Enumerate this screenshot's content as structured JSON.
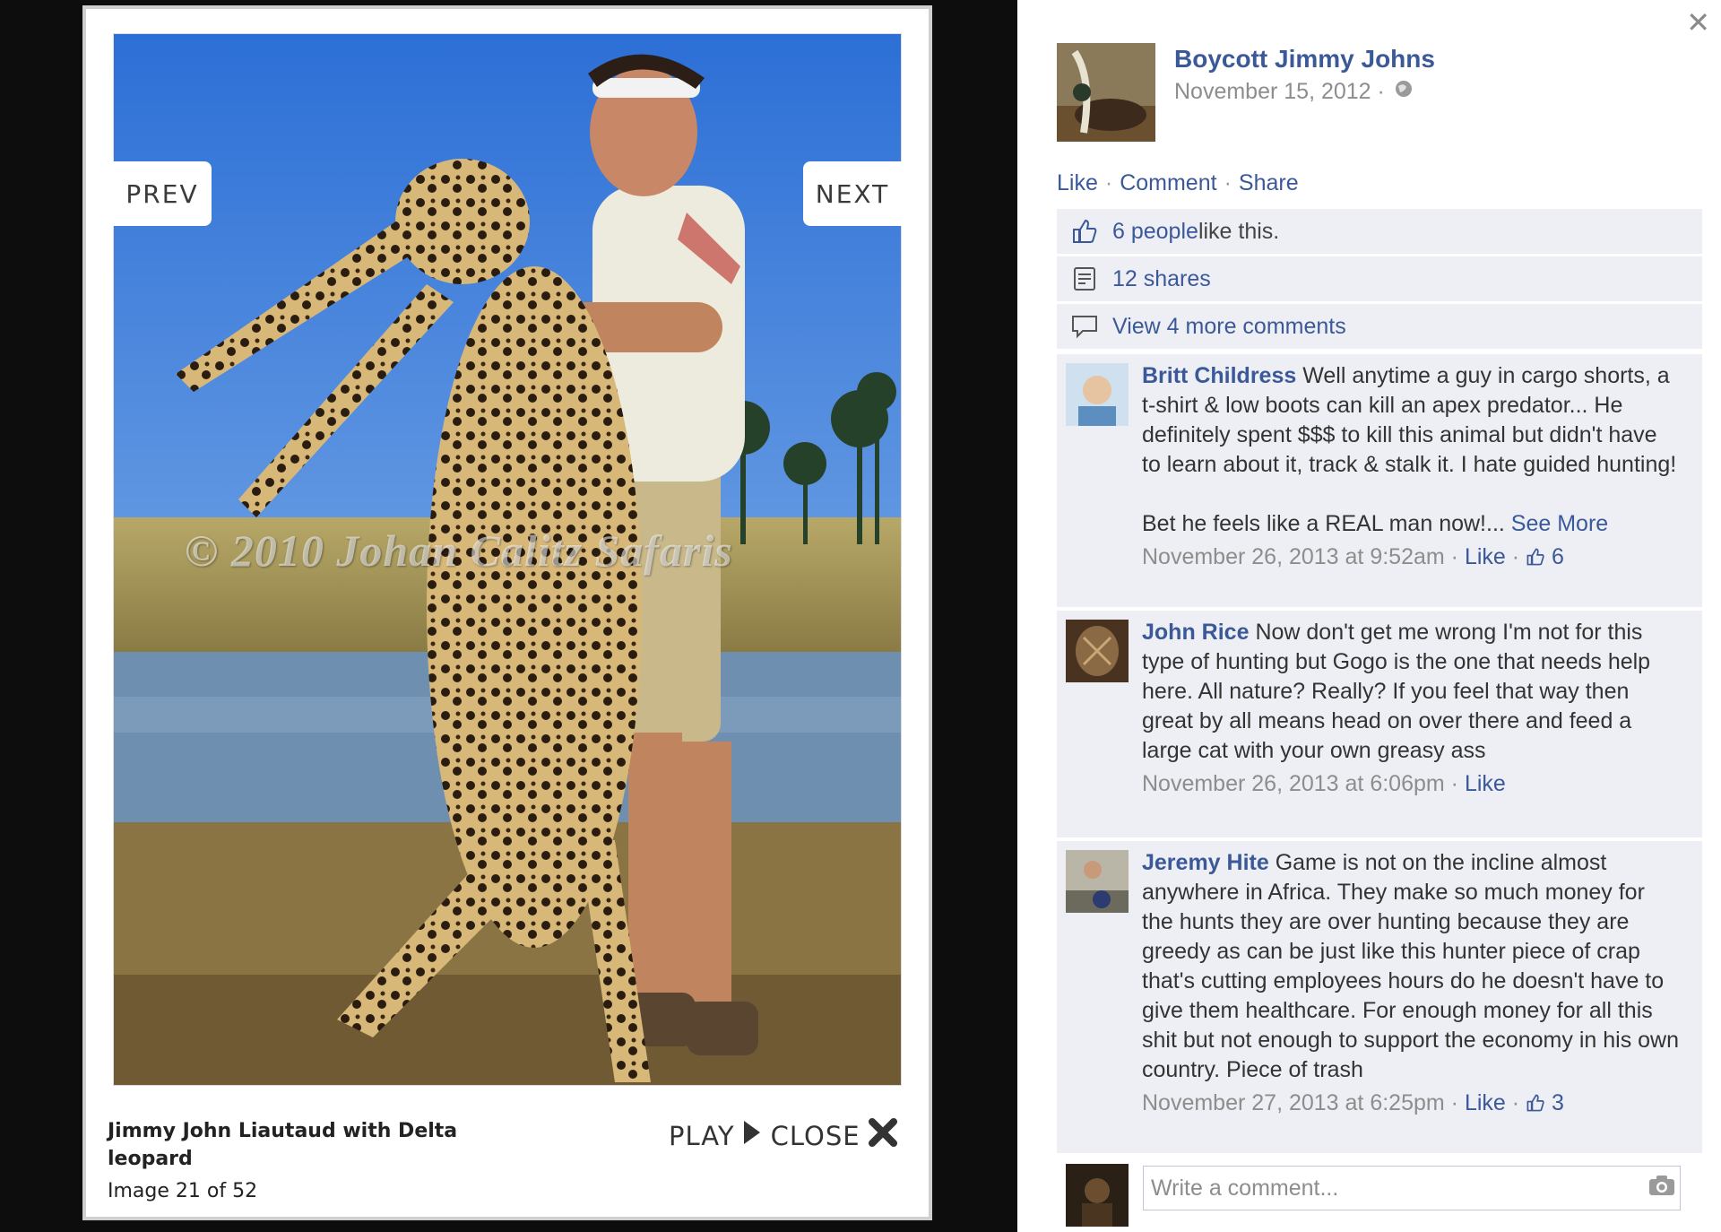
{
  "lightbox": {
    "prev_label": "PREV",
    "next_label": "NEXT",
    "watermark": "© 2010 Johan Calitz Safaris",
    "caption": "Jimmy John Liautaud with Delta leopard",
    "counter": "Image 21 of 52",
    "play_label": "PLAY",
    "close_label": "CLOSE"
  },
  "post": {
    "page_name": "Boycott Jimmy Johns",
    "date": "November 15, 2012 ·",
    "actions": {
      "like": "Like",
      "comment": "Comment",
      "share": "Share",
      "sep": "·"
    },
    "likes_link": "6 people",
    "likes_text": " like this.",
    "shares": "12 shares",
    "view_more": "View 4 more comments"
  },
  "comments": [
    {
      "name": "Britt Childress",
      "text": "Well anytime a guy in cargo shorts, a t-shirt & low boots can kill an apex predator... He definitely spent $$$ to kill this animal but didn't have to learn about it, track & stalk it. I hate guided hunting!",
      "text2": "Bet he feels like a REAL man now!...",
      "see_more": "See More",
      "time": "November 26, 2013 at 9:52am",
      "like": "Like",
      "like_count": "6"
    },
    {
      "name": "John Rice",
      "text": "Now don't get me wrong I'm not for this type of hunting but Gogo is the one that needs help here. All nature? Really? If you feel that way then great by all means head on over there and feed a large cat with your own greasy ass",
      "time": "November 26, 2013 at 6:06pm",
      "like": "Like"
    },
    {
      "name": "Jeremy Hite",
      "text": "Game is not on the incline almost anywhere in Africa. They make so much money for the hunts they are over hunting because they are greedy as can be just like this hunter piece of crap that's cutting employees hours do he doesn't have to give them healthcare. For enough money for all this shit but not enough to support the economy in his own country. Piece of trash",
      "time": "November 27, 2013 at 6:25pm",
      "like": "Like",
      "like_count": "3"
    }
  ],
  "composer": {
    "placeholder": "Write a comment..."
  },
  "colors": {
    "fb_blue": "#3b5998",
    "panel_bg": "#edeff4",
    "muted": "#8d8d8d"
  },
  "icons": [
    "close-icon",
    "globe-icon",
    "thumbs-up-icon",
    "share-icon",
    "comment-bubble-icon",
    "play-icon",
    "close-x-icon",
    "camera-icon"
  ]
}
